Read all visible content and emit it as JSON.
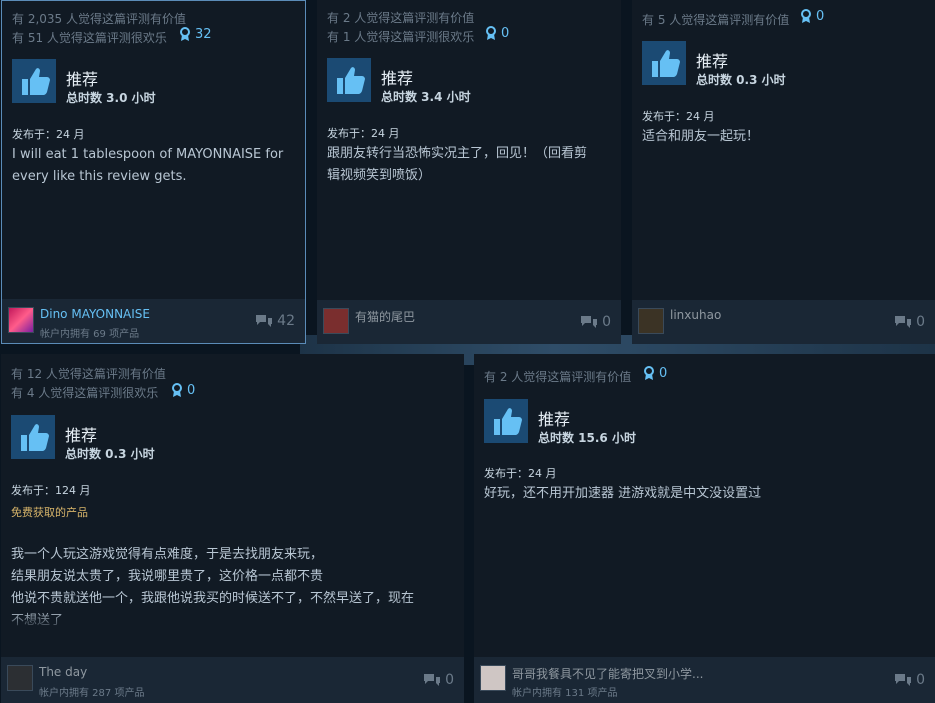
{
  "reviews": [
    {
      "helpful": "有 2,035 人觉得这篇评测有价值",
      "funny": "有 51 人觉得这篇评测很欢乐",
      "awards": "32",
      "verdict": "推荐",
      "hours": "总时数 3.0 小时",
      "posted": "发布于：24 月",
      "body": [
        "I will eat 1 tablespoon of MAYONNAISE for",
        "every like this review gets."
      ],
      "user": "Dino MAYONNAISE",
      "owns": "帐户内拥有 69 项产品",
      "comments": "42"
    },
    {
      "helpful": "有 2 人觉得这篇评测有价值",
      "funny": "有 1 人觉得这篇评测很欢乐",
      "awards": "0",
      "verdict": "推荐",
      "hours": "总时数 3.4 小时",
      "posted": "发布于：24 月",
      "body": [
        "跟朋友转行当恐怖实况主了，回见！（回看剪",
        "辑视频笑到喷饭）"
      ],
      "user": "有猫的尾巴",
      "comments": "0"
    },
    {
      "helpful": "有 5 人觉得这篇评测有价值",
      "awards": "0",
      "verdict": "推荐",
      "hours": "总时数 0.3 小时",
      "posted": "发布于：24 月",
      "body": [
        "适合和朋友一起玩！"
      ],
      "user": "linxuhao",
      "comments": "0"
    },
    {
      "helpful": "有 12 人觉得这篇评测有价值",
      "funny": "有 4 人觉得这篇评测很欢乐",
      "awards": "0",
      "verdict": "推荐",
      "hours": "总时数 0.3 小时",
      "posted": "发布于：124 月",
      "free": "免费获取的产品",
      "body": [
        "我一个人玩这游戏觉得有点难度，于是去找朋友来玩，",
        "结果朋友说太贵了，我说哪里贵了，这价格一点都不贵",
        "他说不贵就送他一个，我跟他说我买的时候送不了，不然早送了，现在",
        "不想送了"
      ],
      "user": "The day",
      "owns": "帐户内拥有 287 项产品",
      "comments": "0"
    },
    {
      "helpful": "有 2 人觉得这篇评测有价值",
      "awards": "0",
      "verdict": "推荐",
      "hours": "总时数 15.6 小时",
      "posted": "发布于：24 月",
      "body": [
        "好玩，还不用开加速器 进游戏就是中文没设置过"
      ],
      "user": "哥哥我餐具不见了能寄把叉到小学...",
      "owns": "帐户内拥有 131 项产品",
      "comments": "0"
    }
  ],
  "colors": {
    "accent": "#66c0f4",
    "card": "#111a24",
    "footer": "#1a2735"
  },
  "icons": {
    "thumb": "thumbs-up-icon",
    "award": "award-ribbon-icon",
    "comment": "comment-bubbles-icon"
  }
}
